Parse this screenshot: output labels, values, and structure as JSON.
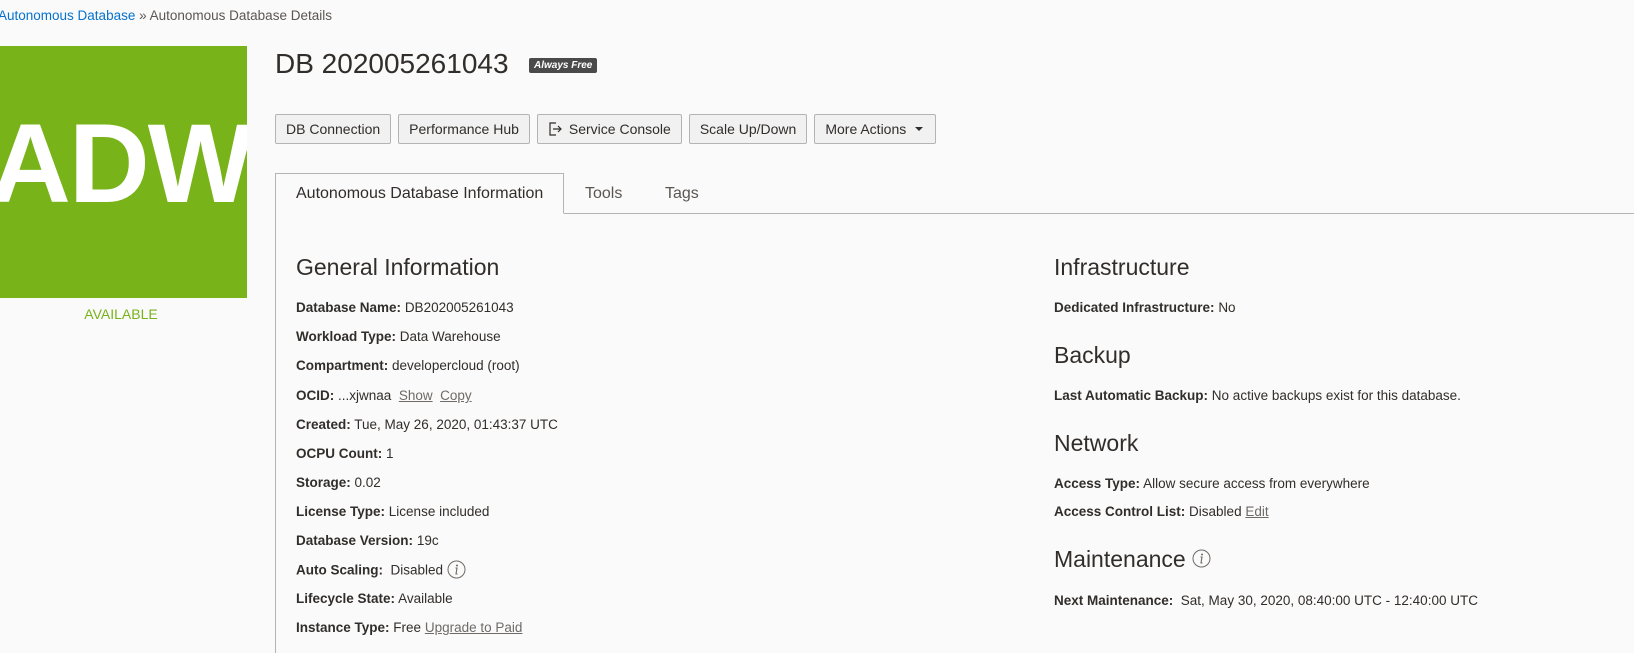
{
  "breadcrumb": {
    "parent": "Autonomous Database",
    "separator": " » ",
    "current": "Autonomous Database Details"
  },
  "logo": {
    "text": "ADW",
    "status": "AVAILABLE",
    "color": "#78b319"
  },
  "header": {
    "title": "DB 202005261043",
    "badge": "Always Free"
  },
  "toolbar": {
    "db_connection": "DB Connection",
    "performance_hub": "Performance Hub",
    "service_console": "Service Console",
    "scale": "Scale Up/Down",
    "more_actions": "More Actions"
  },
  "tabs": [
    {
      "label": "Autonomous Database Information"
    },
    {
      "label": "Tools"
    },
    {
      "label": "Tags"
    }
  ],
  "general": {
    "heading": "General Information",
    "rows": [
      {
        "label": "Database Name:",
        "value": "DB202005261043"
      },
      {
        "label": "Workload Type:",
        "value": "Data Warehouse"
      },
      {
        "label": "Compartment:",
        "value": "developercloud (root)"
      },
      {
        "label": "OCID:",
        "value": "...xjwnaa",
        "link1": "Show",
        "link2": "Copy"
      },
      {
        "label": "Created:",
        "value": "Tue, May 26, 2020, 01:43:37 UTC"
      },
      {
        "label": "OCPU Count:",
        "value": "1"
      },
      {
        "label": "Storage:",
        "value": "0.02"
      },
      {
        "label": "License Type:",
        "value": "License included"
      },
      {
        "label": "Database Version:",
        "value": "19c"
      },
      {
        "label": "Auto Scaling:",
        "value": "Disabled"
      },
      {
        "label": "Lifecycle State:",
        "value": "Available"
      },
      {
        "label": "Instance Type:",
        "value": "Free",
        "link1": "Upgrade to Paid"
      }
    ]
  },
  "infrastructure": {
    "heading": "Infrastructure",
    "label": "Dedicated Infrastructure:",
    "value": "No"
  },
  "backup": {
    "heading": "Backup",
    "label": "Last Automatic Backup:",
    "value": "No active backups exist for this database."
  },
  "network": {
    "heading": "Network",
    "access_type_label": "Access Type:",
    "access_type_value": "Allow secure access from everywhere",
    "acl_label": "Access Control List:",
    "acl_value": "Disabled",
    "acl_link": "Edit"
  },
  "maintenance": {
    "heading": "Maintenance",
    "label": "Next Maintenance:",
    "value": "Sat, May 30, 2020, 08:40:00 UTC - 12:40:00 UTC"
  }
}
